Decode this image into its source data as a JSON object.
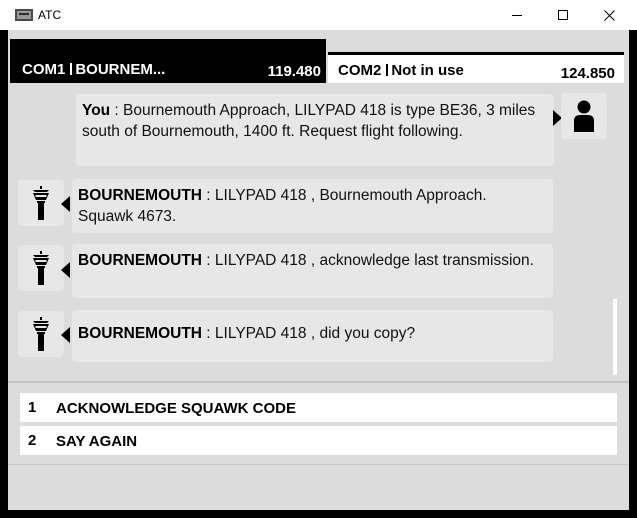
{
  "window": {
    "title": "ATC",
    "icon": "app-icon",
    "controls": [
      "minimize-icon",
      "maximize-icon",
      "close-icon"
    ]
  },
  "radios": {
    "com1": {
      "name": "COM1",
      "station": "BOURNEM...",
      "frequency": "119.480",
      "active": true
    },
    "com2": {
      "name": "COM2",
      "station": "Not in use",
      "frequency": "124.850",
      "active": false
    }
  },
  "messages": [
    {
      "speaker": "You",
      "text": " : Bournemouth Approach, LILYPAD 418 is type BE36, 3 miles south of Bournemouth, 1400 ft. Request flight following.",
      "icon": "pilot-icon"
    },
    {
      "speaker": "BOURNEMOUTH",
      "text": " : LILYPAD 418 , Bournemouth Approach. Squawk 4673.",
      "icon": "control-tower-icon"
    },
    {
      "speaker": "BOURNEMOUTH",
      "text": " : LILYPAD 418 , acknowledge last transmission.",
      "icon": "control-tower-icon"
    },
    {
      "speaker": "BOURNEMOUTH",
      "text": " : LILYPAD 418 , did you copy?",
      "icon": "control-tower-icon"
    }
  ],
  "options": [
    {
      "number": "1",
      "label": "ACKNOWLEDGE SQUAWK CODE"
    },
    {
      "number": "2",
      "label": "SAY AGAIN"
    }
  ],
  "colors": {
    "active_tab": "#000000",
    "inactive_tab": "#ffffff",
    "panel": "#dcdcdc",
    "bubble": "#e7e7e7"
  }
}
